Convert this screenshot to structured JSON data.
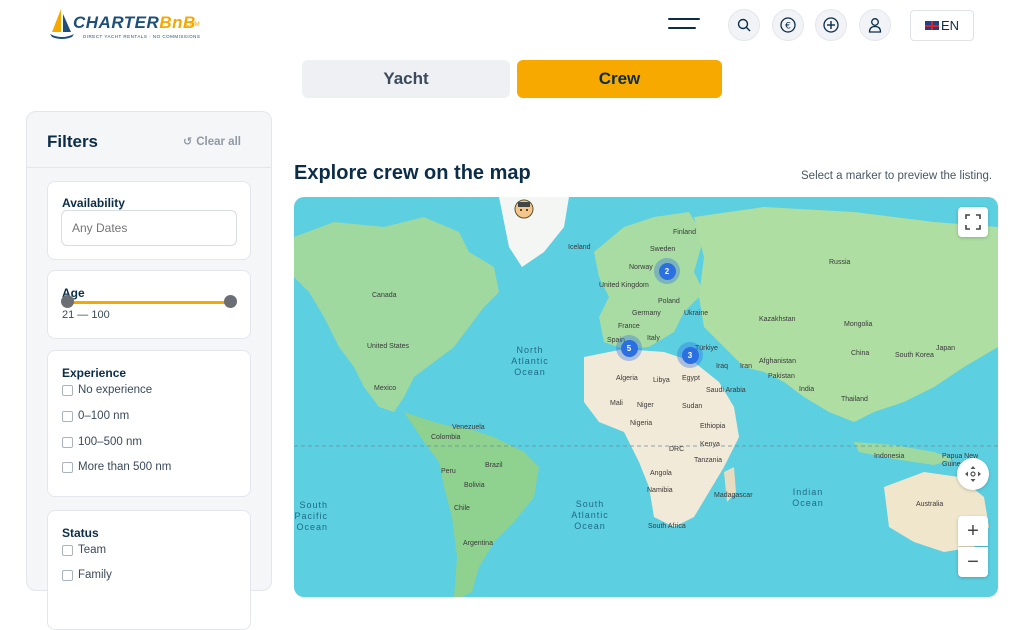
{
  "header": {
    "logo": {
      "brand_main": "CHARTER",
      "brand_accent": "BnB",
      "domain": ".COM",
      "tagline": "DIRECT YACHT RENTALS · NO COMMISSIONS"
    },
    "language": "EN",
    "icons": [
      "menu-icon",
      "search-icon",
      "currency-euro-icon",
      "add-icon",
      "user-icon",
      "uk-flag-icon"
    ]
  },
  "tabs": {
    "yacht": "Yacht",
    "crew": "Crew",
    "active": "Crew"
  },
  "filters": {
    "title": "Filters",
    "clear_all": "Clear all",
    "availability": {
      "title": "Availability",
      "placeholder": "Any Dates"
    },
    "age": {
      "title": "Age",
      "range_label": "21 — 100",
      "min": 21,
      "max": 100
    },
    "experience": {
      "title": "Experience",
      "options": [
        "No experience",
        "0–100 nm",
        "100–500 nm",
        "More than 500 nm"
      ]
    },
    "status": {
      "title": "Status",
      "options": [
        "Team",
        "Family"
      ]
    }
  },
  "map": {
    "title": "Explore crew on the map",
    "hint": "Select a marker to preview the listing.",
    "clusters": [
      {
        "count": "2",
        "region": "Scandinavia"
      },
      {
        "count": "5",
        "region": "Western Mediterranean"
      },
      {
        "count": "3",
        "region": "Eastern Mediterranean"
      }
    ],
    "country_labels": [
      "Finland",
      "Sweden",
      "Norway",
      "Iceland",
      "United Kingdom",
      "Poland",
      "Germany",
      "Ukraine",
      "France",
      "Italy",
      "Türkiye",
      "Spain",
      "Russia",
      "Kazakhstan",
      "Mongolia",
      "China",
      "South Korea",
      "Japan",
      "Afghanistan",
      "Iran",
      "Iraq",
      "Pakistan",
      "India",
      "Thailand",
      "Indonesia",
      "Papua New Guinea",
      "Australia",
      "Canada",
      "United States",
      "Mexico",
      "Venezuela",
      "Colombia",
      "Peru",
      "Brazil",
      "Bolivia",
      "Chile",
      "Argentina",
      "Algeria",
      "Libya",
      "Egypt",
      "Saudi Arabia",
      "Mali",
      "Niger",
      "Sudan",
      "Nigeria",
      "Ethiopia",
      "Kenya",
      "DRC",
      "Tanzania",
      "Angola",
      "Namibia",
      "Madagascar",
      "South Africa"
    ],
    "ocean_labels": [
      "North Atlantic Ocean",
      "South Atlantic Ocean",
      "Indian Ocean",
      "South Pacific Ocean"
    ],
    "controls": {
      "zoom_in": "+",
      "zoom_out": "−"
    }
  }
}
